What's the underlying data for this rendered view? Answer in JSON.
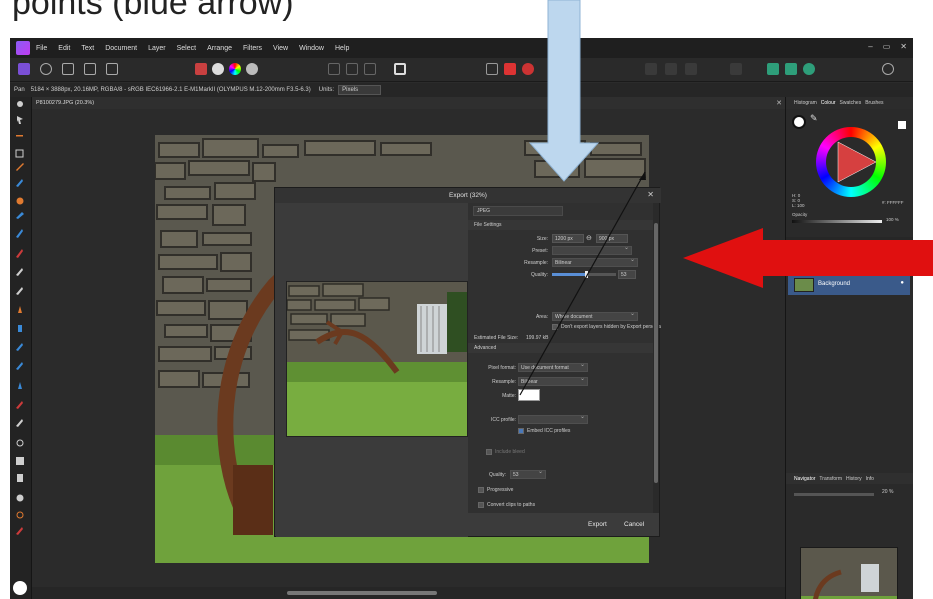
{
  "caption": {
    "top_text": "points (blue arrow)"
  },
  "menu": {
    "items": [
      "File",
      "Edit",
      "Text",
      "Document",
      "Layer",
      "Select",
      "Arrange",
      "Filters",
      "View",
      "Window",
      "Help"
    ],
    "window_controls": [
      "–",
      "▭",
      "✕"
    ]
  },
  "context_bar": {
    "tool": "Pan",
    "info": "5184 × 3888px, 20.16MP, RGBA/8 - sRGB IEC61966-2.1   E-M1MarkII (OLYMPUS M.12-200mm F3.5-6.3)",
    "units_label": "Units:",
    "units_value": "Pixels"
  },
  "document_tab": {
    "name": "P8100279.JPG (20.3%)",
    "close": "✕"
  },
  "export_dialog": {
    "title": "Export (32%)",
    "close": "✕",
    "format": "JPEG",
    "file_settings": {
      "header": "File Settings",
      "size_label": "Size:",
      "width": "1200 px",
      "height": "900 px",
      "preset_label": "Preset:",
      "preset_value": "",
      "resample_label": "Resample:",
      "resample_value": "Bilinear",
      "quality_label": "Quality:",
      "quality_value": "53",
      "quality_level": 0.53,
      "area_label": "Area:",
      "area_value": "Whole document",
      "dont_export_hidden": "Don't export layers hidden by Export persona",
      "estimated_label": "Estimated File Size:",
      "estimated_value": "199.97 kB"
    },
    "advanced": {
      "header": "Advanced",
      "pixel_format_label": "Pixel format:",
      "pixel_format_value": "Use document format",
      "resample_label": "Resample:",
      "resample_value": "Bilinear",
      "matte_label": "Matte:",
      "icc_label": "ICC profile:",
      "icc_value": "",
      "embed_icc": "Embed ICC profiles",
      "include_bleed": "Include bleed",
      "quality_label": "Quality:",
      "quality_value": "53",
      "progressive": "Progressive",
      "convert_clips": "Convert clips to paths"
    },
    "buttons": {
      "export": "Export",
      "cancel": "Cancel"
    }
  },
  "right_panel": {
    "top_tabs": [
      "Histogram",
      "Colour",
      "Swatches",
      "Brushes"
    ],
    "hsl": [
      "H: 0",
      "S: 0",
      "L: 100"
    ],
    "hex": "#: FFFFFF",
    "opacity_label": "Opacity",
    "opacity_value": "100 %",
    "layer_name": "Background",
    "nav_tabs": [
      "Navigator",
      "Transform",
      "History",
      "Info"
    ],
    "zoom_value": "20 %"
  },
  "colors": {
    "blue_arrow": "#bdd7ee",
    "red_arrow": "#e01010",
    "layer_selected": "#3a5a8a"
  }
}
